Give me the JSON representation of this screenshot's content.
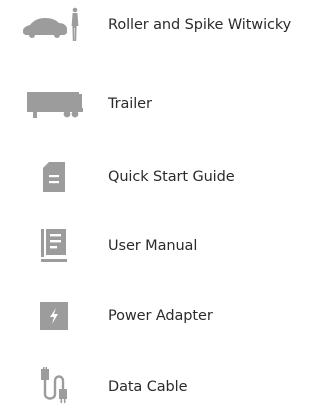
{
  "icon_color": "#9c9c9c",
  "items": [
    {
      "label": "Roller and Spike Witwicky",
      "icon": "car-and-figure-icon"
    },
    {
      "label": "Trailer",
      "icon": "trailer-icon"
    },
    {
      "label": "Quick Start Guide",
      "icon": "document-icon"
    },
    {
      "label": "User Manual",
      "icon": "manual-book-icon"
    },
    {
      "label": "Power Adapter",
      "icon": "lightning-bolt-icon"
    },
    {
      "label": "Data Cable",
      "icon": "usb-cable-icon"
    }
  ]
}
